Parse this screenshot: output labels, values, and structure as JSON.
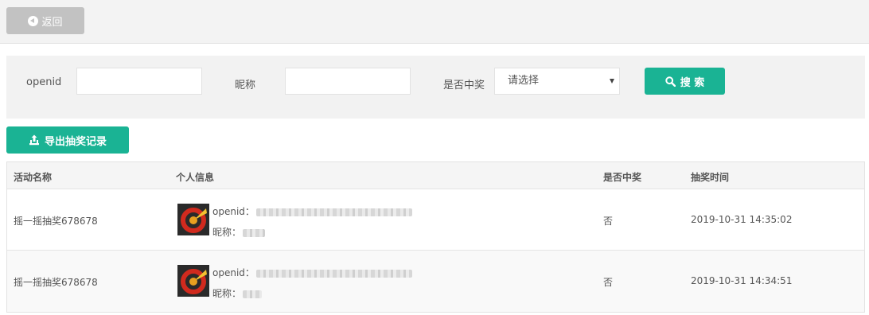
{
  "topbar": {
    "back_label": "返回"
  },
  "filter": {
    "openid_label": "openid",
    "openid_value": "",
    "nickname_label": "昵称",
    "nickname_value": "",
    "won_label": "是否中奖",
    "won_selected": "请选择",
    "search_label": "搜 索"
  },
  "export_label": "导出抽奖记录",
  "table": {
    "headers": [
      "活动名称",
      "个人信息",
      "是否中奖",
      "抽奖时间"
    ],
    "rows": [
      {
        "activity": "摇一摇抽奖678678",
        "openid_label": "openid：",
        "nickname_label": "昵称：",
        "won": "否",
        "time": "2019-10-31 14:35:02"
      },
      {
        "activity": "摇一摇抽奖678678",
        "openid_label": "openid：",
        "nickname_label": "昵称：",
        "won": "否",
        "time": "2019-10-31 14:34:51"
      }
    ]
  },
  "colors": {
    "primary": "#1ab394",
    "back_button": "#c2c2c2"
  },
  "icons": {
    "back": "arrow-circle-left-icon",
    "search": "search-icon",
    "export": "export-icon",
    "select": "caret-down-icon"
  }
}
